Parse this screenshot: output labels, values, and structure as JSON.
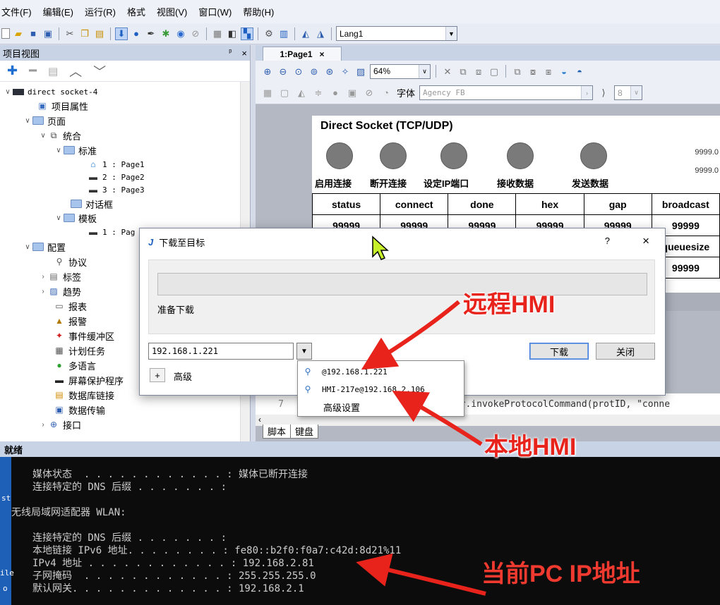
{
  "menubar": {
    "items": [
      "文件(F)",
      "编辑(E)",
      "运行(R)",
      "格式",
      "视图(V)",
      "窗口(W)",
      "帮助(H)"
    ]
  },
  "toolbar": {
    "lang_value": "Lang1"
  },
  "project_panel": {
    "title": "项目视图",
    "pin": "ᵖ",
    "close": "×",
    "tree": [
      {
        "label": "direct socket-4",
        "mono": true
      },
      {
        "label": "项目属性"
      },
      {
        "label": "页面"
      },
      {
        "label": "统合"
      },
      {
        "label": "标准"
      },
      {
        "label": "1 : Page1",
        "mono": true
      },
      {
        "label": "2 : Page2",
        "mono": true
      },
      {
        "label": "3 : Page3",
        "mono": true
      },
      {
        "label": "对话框"
      },
      {
        "label": "模板"
      },
      {
        "label": "1 : Pag",
        "mono": true
      },
      {
        "label": "配置"
      },
      {
        "label": "协议"
      },
      {
        "label": "标签"
      },
      {
        "label": "趋势"
      },
      {
        "label": "报表"
      },
      {
        "label": "报警"
      },
      {
        "label": "事件缓冲区"
      },
      {
        "label": "计划任务"
      },
      {
        "label": "多语言"
      },
      {
        "label": "屏幕保护程序"
      },
      {
        "label": "数据库链接"
      },
      {
        "label": "数据传输"
      },
      {
        "label": "接口"
      }
    ]
  },
  "editor": {
    "tab_label": "1:Page1",
    "tab_close": "×",
    "zoom": "64%",
    "font_label": "字体",
    "font_value": "Agency FB",
    "font_size": "8",
    "canvas": {
      "title": "Direct Socket (TCP/UDP)",
      "right_numbers": [
        "9999.0",
        "9999.0"
      ],
      "button_labels": [
        "启用连接",
        "断开连接",
        "设定IP端口",
        "接收数据",
        "发送数据"
      ],
      "grid_header": [
        "status",
        "connect",
        "done",
        "hex",
        "gap",
        "broadcast"
      ],
      "grid_row1": [
        "99999",
        "99999",
        "99999",
        "99999",
        "99999",
        "99999"
      ],
      "grid_side": [
        "queuesize",
        "99999"
      ]
    },
    "code_line_no": "7",
    "code_text": "Mgr.invokeProtocolCommand(protID, \"conne",
    "bottom_tabs": [
      "脚本",
      "键盘"
    ]
  },
  "statusbar": {
    "text": "就绪"
  },
  "dialog": {
    "title": "下载至目标",
    "help": "?",
    "close": "×",
    "status": "准备下载",
    "target_value": "192.168.1.221",
    "download_button": "下载",
    "close_button": "关闭",
    "advanced_toggle": "+",
    "advanced_label": "高级",
    "dropdown_items": [
      "@192.168.1.221",
      "HMI-217e@192.168.2.106",
      "高级设置"
    ]
  },
  "terminal": {
    "lines": [
      {
        "text": "媒体状态  . . . . . . . . . . . . : 媒体已断开连接",
        "indent": true
      },
      {
        "text": "连接特定的 DNS 后缀 . . . . . . . :",
        "indent": true
      },
      {
        "text": "无线局域网适配器 WLAN:",
        "indent": false
      },
      {
        "text": "连接特定的 DNS 后缀 . . . . . . . :",
        "indent": true
      },
      {
        "text": "本地链接 IPv6 地址. . . . . . . . : fe80::b2f0:f0a7:c42d:8d21%11",
        "indent": true
      },
      {
        "text": "IPv4 地址 . . . . . . . . . . . . : 192.168.2.81",
        "indent": true
      },
      {
        "text": "子网掩码  . . . . . . . . . . . . : 255.255.255.0",
        "indent": true
      },
      {
        "text": "默认网关. . . . . . . . . . . . . : 192.168.2.1",
        "indent": true
      }
    ],
    "desktop_fragments": [
      "st",
      "ile",
      "o"
    ]
  },
  "annotations": {
    "remote_hmi": "远程HMI",
    "local_hmi": "本地HMI",
    "current_pc_ip": "当前PC IP地址"
  },
  "colors": {
    "annotation_red": "#e8231c",
    "panel_header": "#c9d3e6"
  }
}
